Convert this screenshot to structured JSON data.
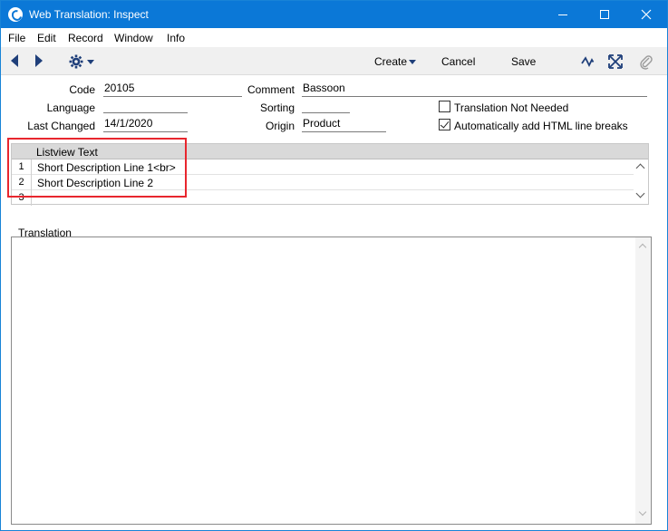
{
  "window": {
    "title": "Web Translation: Inspect"
  },
  "menu": [
    "File",
    "Edit",
    "Record",
    "Window",
    "Info"
  ],
  "toolbar": {
    "create_label": "Create",
    "cancel_label": "Cancel",
    "save_label": "Save"
  },
  "form": {
    "code": {
      "label": "Code",
      "value": "20105"
    },
    "language": {
      "label": "Language",
      "value": ""
    },
    "last_changed": {
      "label": "Last Changed",
      "value": "14/1/2020"
    },
    "comment": {
      "label": "Comment",
      "value": "Bassoon"
    },
    "sorting": {
      "label": "Sorting",
      "value": ""
    },
    "origin": {
      "label": "Origin",
      "value": "Product"
    },
    "translation_not_needed": {
      "label": "Translation Not Needed",
      "checked": false
    },
    "auto_html_breaks": {
      "label": "Automatically add HTML line breaks",
      "checked": true
    }
  },
  "matrix": {
    "header": "Listview Text",
    "rows": [
      {
        "num": "1",
        "text": "Short Description Line 1<br>"
      },
      {
        "num": "2",
        "text": "Short Description Line 2"
      },
      {
        "num": "3",
        "text": ""
      }
    ]
  },
  "translation": {
    "label": "Translation",
    "value": ""
  },
  "colors": {
    "titlebar": "#0b78d7",
    "highlight": "#e8262e",
    "icon": "#1f3f7a"
  }
}
